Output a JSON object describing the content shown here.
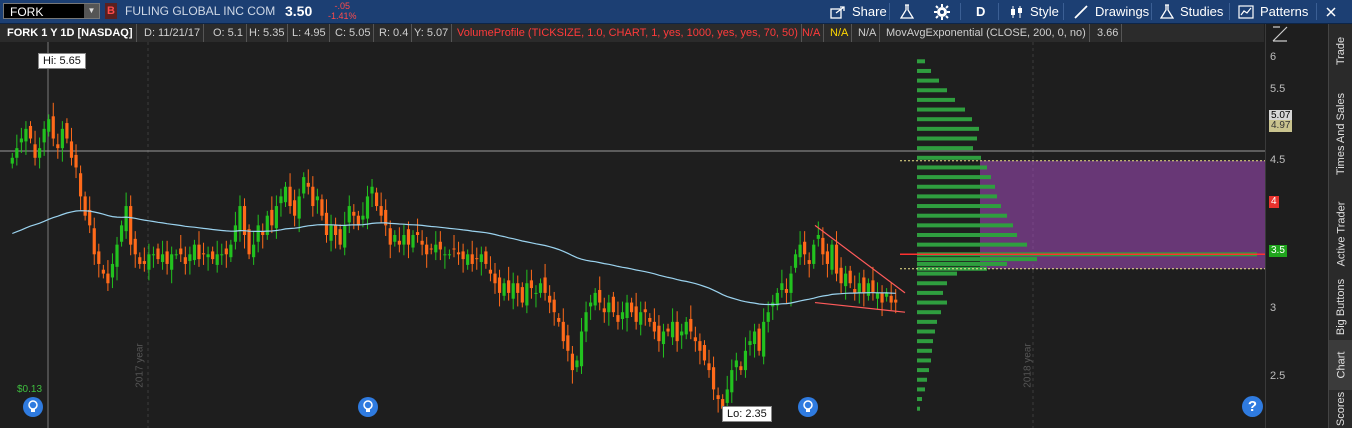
{
  "toolbar": {
    "symbol": "FORK",
    "alert_icon": "B",
    "company": "FULING GLOBAL INC COM",
    "last_price": "3.50",
    "net_change": "-.05",
    "pct_change": "-1.41%",
    "share_label": "Share",
    "aggregation_label": "D",
    "style_label": "Style",
    "drawings_label": "Drawings",
    "studies_label": "Studies",
    "patterns_label": "Patterns"
  },
  "infobar": {
    "title": "FORK 1 Y 1D [NASDAQ]",
    "date": "D: 11/21/17",
    "open": "O: 5.1",
    "high": "H: 5.35",
    "low": "L: 4.95",
    "close": "C: 5.05",
    "range": "R: 0.4",
    "y": "Y: 5.07",
    "volume_profile": "VolumeProfile (TICKSIZE, 1.0, CHART, 1, yes, 1000, yes, yes, 70, 50)",
    "na1": "N/A",
    "na2": "N/A",
    "na3": "N/A",
    "mov_avg": "MovAvgExponential (CLOSE, 200, 0, no)",
    "mov_avg_value": "3.66"
  },
  "chart": {
    "high_callout": "Hi: 5.65",
    "low_callout": "Lo: 2.35",
    "pl_label": "$0.13",
    "year_2017": "2017 year",
    "year_2018": "2018 year",
    "y_ticks": [
      "6",
      "5.5",
      "5",
      "4.5",
      "4",
      "3.5",
      "3",
      "2.5"
    ],
    "y_price_labels": {
      "upper": "5.07",
      "upper_behind": "4.97",
      "poc": "4",
      "current": "3.5"
    },
    "colors": {
      "up": "#22c21f",
      "down": "#ff6a1a",
      "ema": "#9bd3ef",
      "profile": "#2f9e3f",
      "value_area": "#a64dbf",
      "poc": "#ff3030"
    }
  },
  "chart_data": {
    "type": "candlestick",
    "title": "FORK 1 Y 1D [NASDAQ]",
    "ylim": [
      2.2,
      6.2
    ],
    "high": 5.65,
    "low": 2.35,
    "last": 3.5,
    "ema_200_last": 3.66,
    "volume_profile": {
      "poc": 4.0,
      "value_area_high": 4.97,
      "value_area_low": 3.85
    },
    "closes": [
      5.0,
      5.1,
      5.2,
      5.3,
      5.2,
      5.0,
      5.1,
      5.3,
      5.4,
      5.2,
      5.1,
      5.3,
      5.2,
      5.0,
      4.9,
      4.6,
      4.4,
      4.3,
      4.0,
      3.9,
      3.8,
      3.7,
      3.9,
      4.1,
      4.3,
      4.5,
      4.1,
      4.0,
      3.9,
      3.9,
      4.0,
      4.0,
      3.95,
      4.0,
      3.9,
      4.0,
      4.0,
      4.0,
      3.9,
      4.0,
      4.1,
      3.95,
      4.0,
      4.0,
      3.95,
      4.0,
      4.0,
      4.0,
      4.1,
      4.3,
      4.5,
      4.2,
      4.0,
      4.1,
      4.3,
      4.2,
      4.4,
      4.3,
      4.5,
      4.6,
      4.7,
      4.5,
      4.4,
      4.6,
      4.8,
      4.7,
      4.5,
      4.6,
      4.4,
      4.2,
      4.3,
      4.2,
      4.1,
      4.3,
      4.5,
      4.4,
      4.3,
      4.4,
      4.6,
      4.7,
      4.5,
      4.4,
      4.3,
      4.1,
      4.2,
      4.1,
      4.2,
      4.1,
      4.2,
      4.2,
      4.1,
      4.0,
      4.05,
      4.1,
      4.05,
      4.0,
      4.0,
      4.05,
      4.0,
      3.95,
      4.0,
      3.9,
      3.95,
      4.0,
      3.9,
      3.8,
      3.7,
      3.6,
      3.7,
      3.6,
      3.7,
      3.6,
      3.5,
      3.7,
      3.65,
      3.6,
      3.7,
      3.6,
      3.5,
      3.4,
      3.3,
      3.1,
      3.0,
      2.8,
      2.9,
      3.2,
      3.4,
      3.5,
      3.6,
      3.5,
      3.4,
      3.5,
      3.4,
      3.3,
      3.4,
      3.5,
      3.4,
      3.3,
      3.4,
      3.4,
      3.3,
      3.2,
      3.1,
      3.2,
      3.2,
      3.3,
      3.1,
      3.2,
      3.3,
      3.2,
      3.1,
      3.0,
      2.9,
      2.8,
      2.6,
      2.5,
      2.4,
      2.6,
      2.8,
      2.9,
      2.8,
      3.0,
      3.1,
      3.2,
      3.0,
      3.3,
      3.4,
      3.5,
      3.6,
      3.7,
      3.6,
      3.8,
      4.0,
      4.1,
      4.0,
      3.9,
      4.1,
      4.2,
      4.0,
      3.9,
      4.1,
      3.8,
      3.7,
      3.8,
      3.7,
      3.6,
      3.7,
      3.6,
      3.7,
      3.6,
      3.6,
      3.5,
      3.6,
      3.5,
      3.5
    ]
  },
  "sidebar": {
    "tabs": [
      "Trade",
      "Times And Sales",
      "Active Trader",
      "Big Buttons",
      "Chart",
      "Scores"
    ]
  }
}
